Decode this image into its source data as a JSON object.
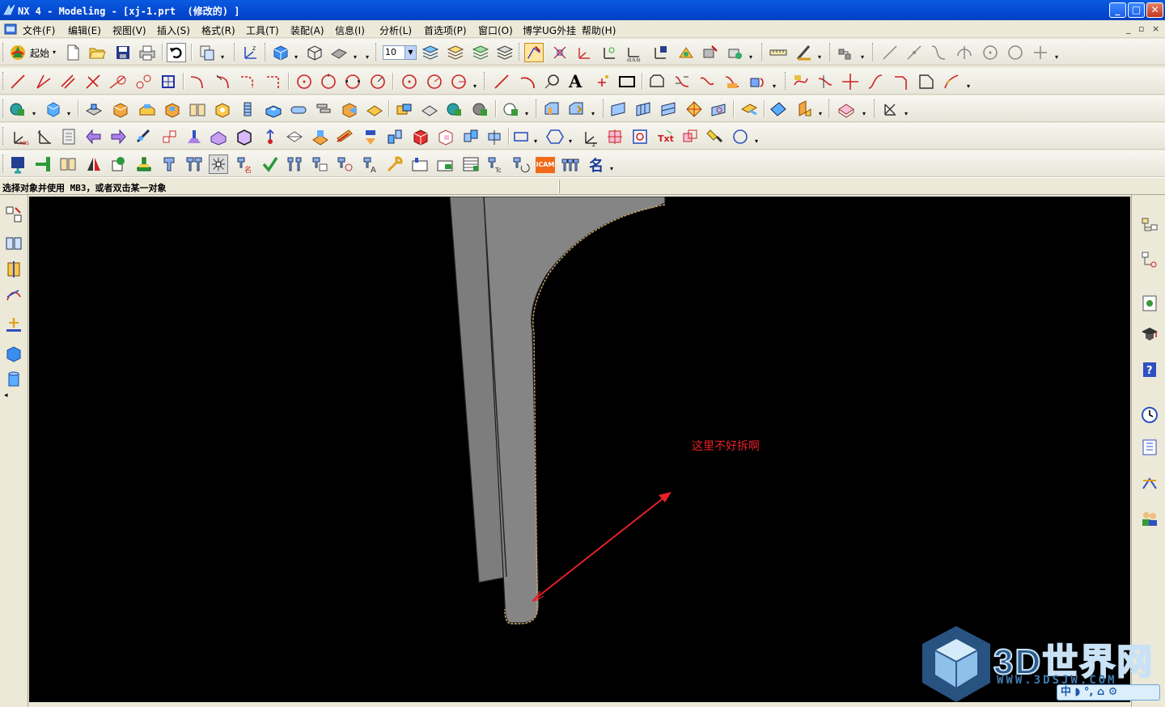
{
  "window": {
    "title": "NX 4 - Modeling - [xj-1.prt  (修改的) ]",
    "minimize_label": "_",
    "maximize_label": "□",
    "close_label": "✕"
  },
  "menubar": {
    "items": [
      {
        "label": "文件(F)"
      },
      {
        "label": "编辑(E)"
      },
      {
        "label": "视图(V)"
      },
      {
        "label": "插入(S)"
      },
      {
        "label": "格式(R)"
      },
      {
        "label": "工具(T)"
      },
      {
        "label": "装配(A)"
      },
      {
        "label": "信息(I)"
      },
      {
        "label": "分析(L)"
      },
      {
        "label": "首选项(P)"
      },
      {
        "label": "窗口(O)"
      },
      {
        "label": "博学UG外挂"
      },
      {
        "label": "帮助(H)"
      }
    ],
    "mdi_minimize": "_",
    "mdi_restore": "▫",
    "mdi_close": "×"
  },
  "toolbar": {
    "start_label": "起始",
    "layer_combo_value": "10",
    "text_tool_label": "A",
    "icam_label": "iCAM",
    "name_tool_label": "名"
  },
  "status": {
    "cue_line": "选择对象并使用 MB3，或者双击某一对象"
  },
  "viewport": {
    "annotation": "这里不好拆啊",
    "background_color": "#000000",
    "annotation_color": "#e8202a"
  },
  "watermark": {
    "text": "3D世界网",
    "url": "WWW.3DSJW.COM"
  },
  "ime": {
    "label": "中 ◗ °, ⌂ ⚙"
  },
  "colors": {
    "titlebar": "#0548d2",
    "chrome": "#ece9d8",
    "part_gray": "#7d7d7d",
    "arrow": "#e8202a"
  }
}
